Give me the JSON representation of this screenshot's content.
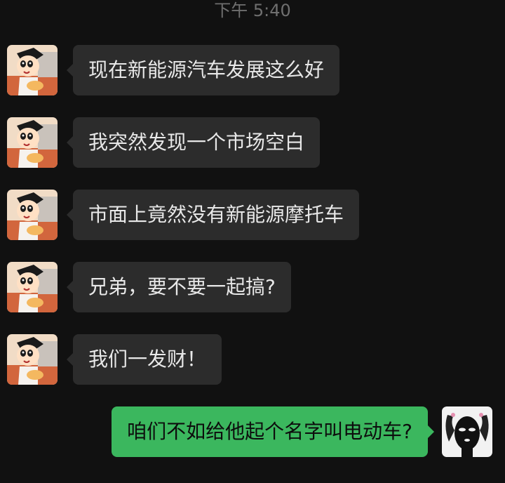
{
  "status": {
    "timestamp": "下午 5:40"
  },
  "messages": [
    {
      "side": "left",
      "avatar": "crayon-shinchan-avatar",
      "text": "现在新能源汽车发展这么好"
    },
    {
      "side": "left",
      "avatar": "crayon-shinchan-avatar",
      "text": "我突然发现一个市场空白"
    },
    {
      "side": "left",
      "avatar": "crayon-shinchan-avatar",
      "text": "市面上竟然没有新能源摩托车"
    },
    {
      "side": "left",
      "avatar": "crayon-shinchan-avatar",
      "text": "兄弟，要不要一起搞?"
    },
    {
      "side": "left",
      "avatar": "crayon-shinchan-avatar",
      "text": "我们一发财！"
    },
    {
      "side": "right",
      "avatar": "masked-character-avatar",
      "text": "咱们不如给他起个名字叫电动车?"
    }
  ],
  "colors": {
    "background": "#111111",
    "incoming_bubble": "#2c2c2c",
    "outgoing_bubble": "#3bb75e",
    "timestamp_text": "#6f6f6f"
  }
}
